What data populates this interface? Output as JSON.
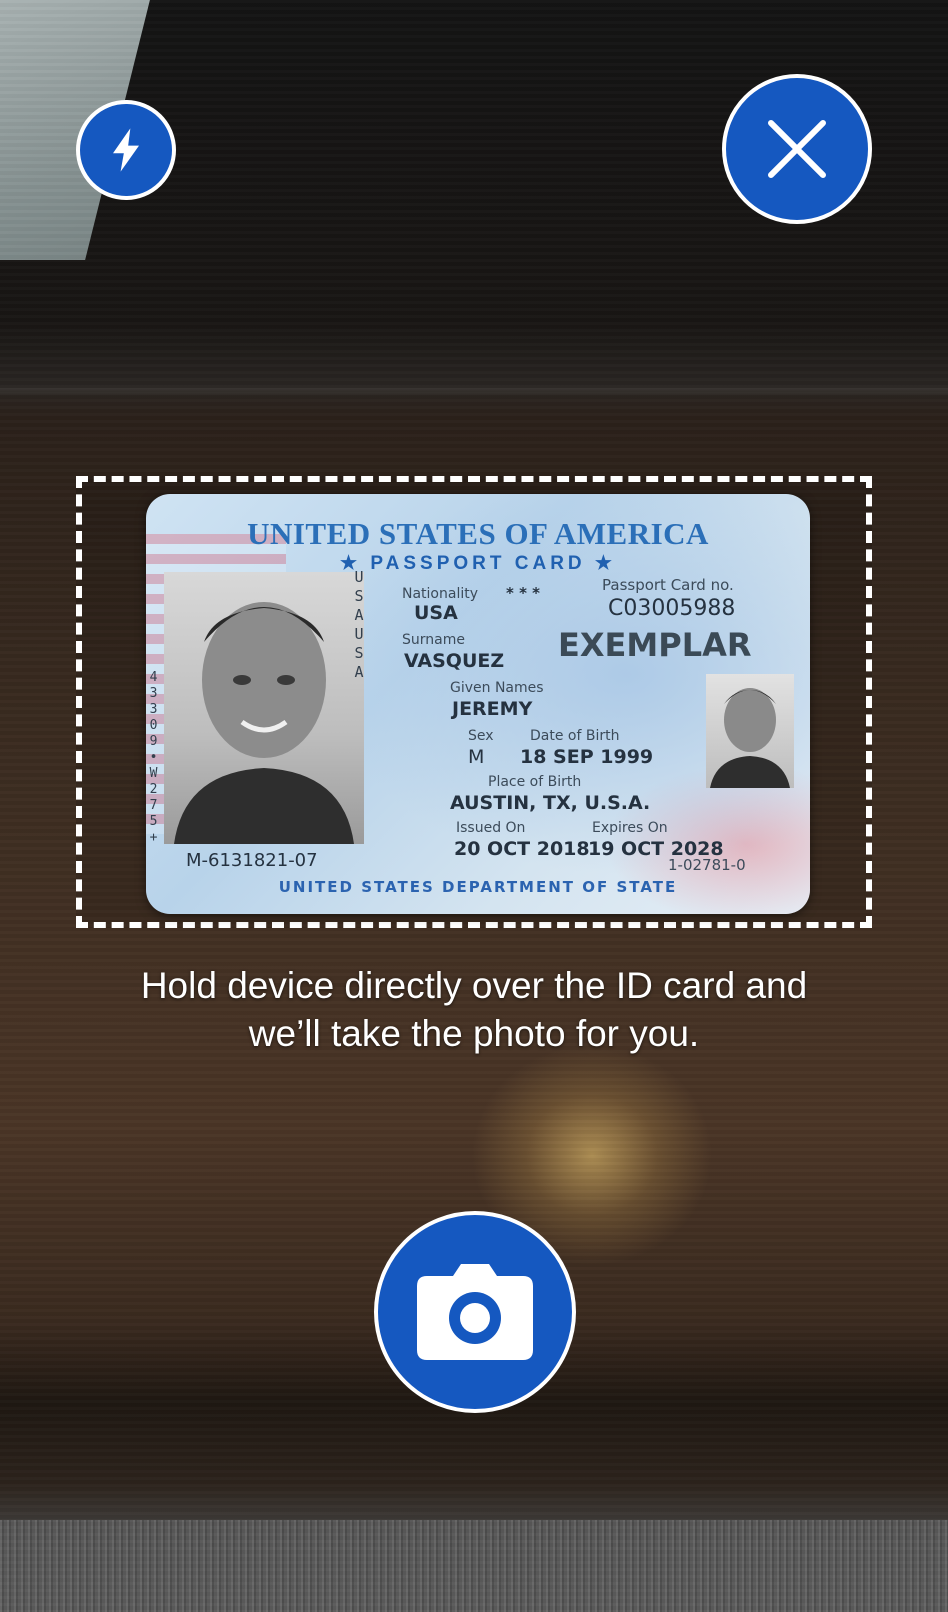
{
  "hint": {
    "line1": "Hold device directly over the ID card and",
    "line2": "we’ll take the photo for you."
  },
  "buttons": {
    "flash_icon": "flash-icon",
    "close_icon": "close-icon",
    "shutter_icon": "camera-icon"
  },
  "card": {
    "country": "UNITED STATES OF AMERICA",
    "doc_type": "★ PASSPORT CARD ★",
    "nationality_label": "Nationality",
    "nationality": "USA",
    "stars": "* * *",
    "card_no_label": "Passport Card no.",
    "card_no": "C03005988",
    "exemplar": "EXEMPLAR",
    "surname_label": "Surname",
    "surname": "VASQUEZ",
    "given_label": "Given Names",
    "given": "JEREMY",
    "sex_label": "Sex",
    "sex": "M",
    "dob_label": "Date of Birth",
    "dob": "18 SEP 1999",
    "pob_label": "Place of Birth",
    "pob": "AUSTIN, TX,  U.S.A.",
    "issued_label": "Issued On",
    "issued": "20 OCT 2018",
    "expires_label": "Expires On",
    "expires": "19 OCT 2028",
    "left_vertical": "43309•W275+",
    "usa_vertical": "USAUSA",
    "doc_number": "M-6131821-07",
    "ref_number": "1-02781-0",
    "department": "UNITED STATES DEPARTMENT OF STATE"
  },
  "colors": {
    "button_blue": "#1558c0",
    "frame": "#ffffff"
  }
}
